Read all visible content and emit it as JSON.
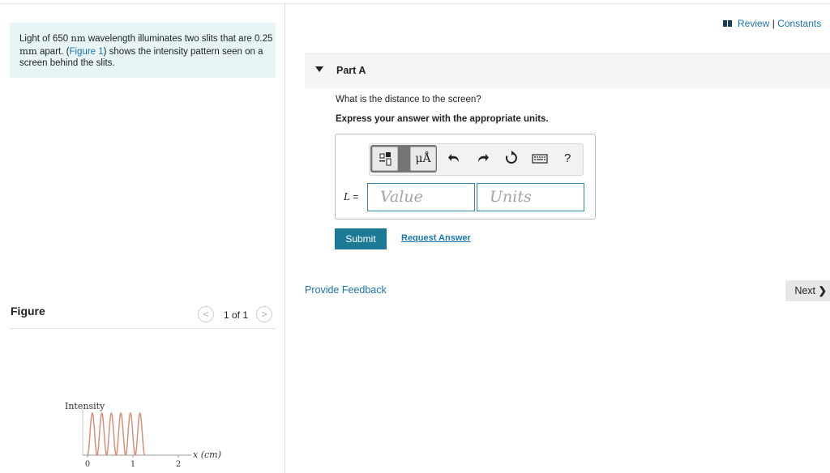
{
  "header": {
    "review_link": "Review",
    "separator": "|",
    "constants_link": "Constants"
  },
  "problem": {
    "text_1": "Light of 650 ",
    "unit_nm": "nm",
    "text_2": " wavelength illuminates two slits that are 0.25 ",
    "unit_mm": "mm",
    "text_3": " apart. (",
    "figure_link": "Figure 1",
    "text_4": ") shows the intensity pattern seen on a screen behind the slits."
  },
  "figure_panel": {
    "title": "Figure",
    "pager": "1 of 1",
    "prev_icon": "chevron-left-icon",
    "next_icon": "chevron-right-icon"
  },
  "part": {
    "title": "Part A",
    "question": "What is the distance to the screen?",
    "instruction": "Express your answer with the appropriate units.",
    "variable": "L",
    "equals": " =",
    "value_placeholder": "Value",
    "units_placeholder": "Units",
    "toolbar": {
      "templates_icon": "templates-icon",
      "units_label": "μÅ",
      "undo_icon": "undo-icon",
      "redo_icon": "redo-icon",
      "reset_icon": "reset-icon",
      "keyboard_icon": "keyboard-icon",
      "help_label": "?"
    },
    "submit_label": "Submit",
    "request_answer_label": "Request Answer"
  },
  "footer": {
    "feedback_label": "Provide Feedback",
    "next_label": "Next"
  },
  "chart_data": {
    "type": "line",
    "ylabel": "Intensity",
    "xlabel": "x (cm)",
    "x_ticks": [
      "0",
      "1",
      "2"
    ],
    "fringe_spacing_cm": 0.21,
    "fringe_count": 6,
    "x_range": [
      0,
      2.2
    ],
    "color": "#d9907a"
  },
  "colors": {
    "link": "#1a76ae",
    "problem_bg": "#e7f5f7",
    "submit_bg": "#1c7a97",
    "field_border": "#2f87a8"
  }
}
